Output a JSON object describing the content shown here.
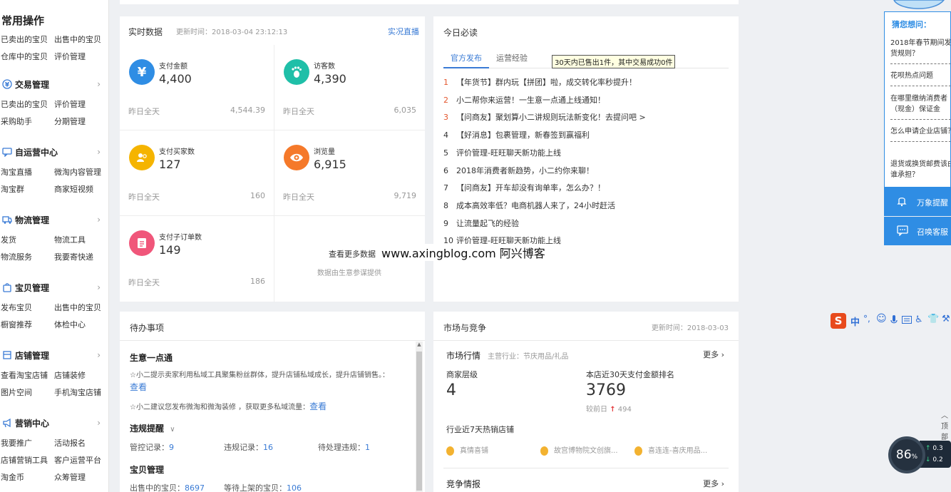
{
  "sidebar": {
    "title": "常用操作",
    "quick_links": [
      "已卖出的宝贝",
      "出售中的宝贝",
      "仓库中的宝贝",
      "评价管理"
    ],
    "groups": [
      {
        "name": "交易管理",
        "links": [
          "已卖出的宝贝",
          "评价管理",
          "采购助手",
          "分期管理"
        ]
      },
      {
        "name": "自运营中心",
        "links": [
          "淘宝直播",
          "微淘内容管理",
          "淘宝群",
          "商家短视频"
        ]
      },
      {
        "name": "物流管理",
        "links": [
          "发货",
          "物流工具",
          "物流服务",
          "我要寄快递"
        ]
      },
      {
        "name": "宝贝管理",
        "links": [
          "发布宝贝",
          "出售中的宝贝",
          "橱窗推荐",
          "体检中心"
        ]
      },
      {
        "name": "店铺管理",
        "links": [
          "查看淘宝店铺",
          "店铺装修",
          "图片空间",
          "手机淘宝店铺"
        ]
      },
      {
        "name": "营销中心",
        "links": [
          "我要推广",
          "活动报名",
          "店铺营销工具",
          "客户运营平台",
          "淘金币",
          "众筹管理"
        ]
      }
    ],
    "arrow": "›"
  },
  "realtime": {
    "title": "实时数据",
    "update_time": "更新时间：2018-03-04 23:12:13",
    "live_link": "实况直播",
    "yesterday_label": "昨日全天",
    "cells": [
      {
        "label": "支付金额",
        "value": "4,400",
        "yesterday": "4,544.39",
        "icon": "¥",
        "color": "#2f8de4"
      },
      {
        "label": "访客数",
        "value": "4,390",
        "yesterday": "6,035",
        "icon": "foot-icon",
        "color": "#1fbfa8"
      },
      {
        "label": "支付买家数",
        "value": "127",
        "yesterday": "160",
        "icon": "buyers-icon",
        "color": "#f5b400"
      },
      {
        "label": "浏览量",
        "value": "6,915",
        "yesterday": "9,719",
        "icon": "eye-icon",
        "color": "#f5792a"
      },
      {
        "label": "支付子订单数",
        "value": "149",
        "yesterday": "186",
        "icon": "order-icon",
        "color": "#f0567a"
      }
    ],
    "more_data": "查看更多数据",
    "data_source": "数据由生意参谋提供"
  },
  "today": {
    "title": "今日必读",
    "tabs": [
      "官方发布",
      "运营经验"
    ],
    "tooltip": "30天内已售出1件，其中交易成功0件",
    "items": [
      {
        "num": "1",
        "text": "【年货节】群内玩【拼团】啦，成交转化率秒提升！"
      },
      {
        "num": "2",
        "text": "小二帮你来运营！一生意一点通上线通知！"
      },
      {
        "num": "3",
        "text": "【问商友】聚划算小二讲规则玩法新变化！去提问吧 >"
      },
      {
        "num": "4",
        "text": "【好消息】包裹管理，新春签到赢福利"
      },
      {
        "num": "5",
        "text": "评价管理-旺旺聊天新功能上线"
      },
      {
        "num": "6",
        "text": "2018年消费者新趋势，小二约你来聊！"
      },
      {
        "num": "7",
        "text": "【问商友】开车却没有询单率，怎么办？！"
      },
      {
        "num": "8",
        "text": "成本高效率低？电商机器人来了，24小时赶活"
      },
      {
        "num": "9",
        "text": "让流量起飞的经验"
      },
      {
        "num": "10",
        "text": "评价管理-旺旺聊天新功能上线"
      }
    ]
  },
  "watermark": "www.axingblog.com 阿兴博客",
  "todo": {
    "title": "待办事项",
    "section1": "生意一点通",
    "tip1": "☆小二提示卖家利用私域工具聚集粉丝群体，提升店铺私域成长，提升店铺销售。：",
    "tip1_link": "查看",
    "tip2": "☆小二建议您发布微淘和微淘装修 ，获取更多私域流量：",
    "tip2_link": "查看",
    "section2": "违规提醒",
    "v1_label": "管控记录：",
    "v1_val": "9",
    "v2_label": "违规记录：",
    "v2_val": "16",
    "v3_label": "待处理违规：",
    "v3_val": "1",
    "section3": "宝贝管理",
    "g1_label": "出售中的宝贝：",
    "g1_val": "8697",
    "g2_label": "等待上架的宝贝：",
    "g2_val": "106"
  },
  "market": {
    "title": "市场与竞争",
    "update_time": "更新时间：2018-03-03",
    "sub_title": "市场行情",
    "industry": "主营行业：节庆用品/礼品",
    "more": "更多",
    "level_label": "商家层级",
    "level_value": "4",
    "rank_label": "本店近30天支付金额排名",
    "rank_value": "3769",
    "compare_label": "较前日",
    "compare_value": "494",
    "hot_title": "行业近7天热销店铺",
    "hot_shops": [
      "真情喜铺",
      "故宫博物院文创旗...",
      "喜连连-喜庆用品..."
    ],
    "compete_title": "竞争情报"
  },
  "right": {
    "guess_title": "猜您想问：",
    "questions": [
      "2018年春节期间发货规则？",
      "花呗热点问题",
      "在哪里缴纳消费者（现金）保证金",
      "怎么申请企业店铺？",
      "退货或换货邮费该由谁承担？"
    ],
    "btn1": "万象提醒",
    "btn2": "召唤客服",
    "top_label": "顶部",
    "gauge": "86",
    "gauge_unit": "%",
    "net1": "0.3",
    "net2": "0.2",
    "ime_text": "中"
  }
}
